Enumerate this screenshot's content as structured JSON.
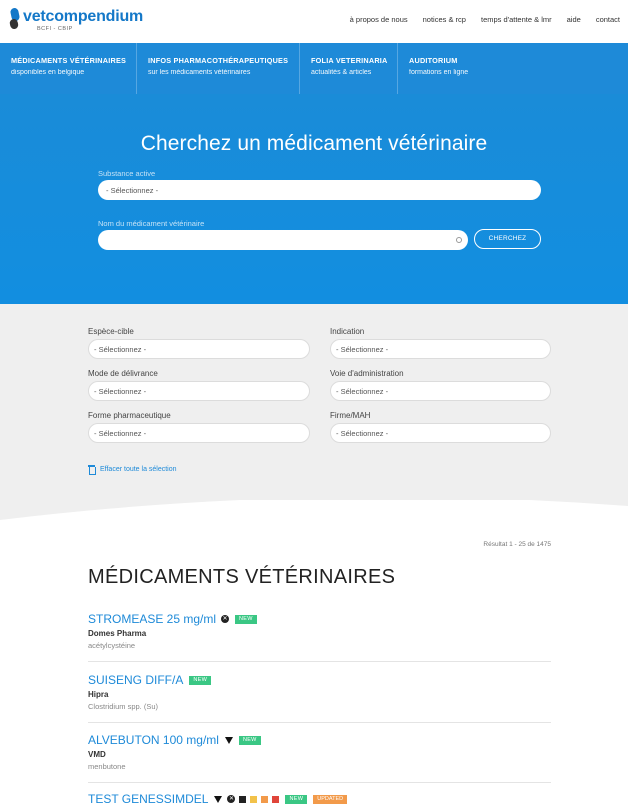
{
  "header": {
    "logo_text": "vetcompendium",
    "logo_sub": "BCFI - CBIP",
    "nav": [
      "à propos de nous",
      "notices & rcp",
      "temps d'attente & lmr",
      "aide",
      "contact"
    ]
  },
  "mainnav": [
    {
      "title": "MÉDICAMENTS VÉTÉRINAIRES",
      "sub": "disponibles en belgique"
    },
    {
      "title": "INFOS PHARMACOTHÉRAPEUTIQUES",
      "sub": "sur les médicaments vétérinaires"
    },
    {
      "title": "FOLIA VETERINARIA",
      "sub": "actualités & articles"
    },
    {
      "title": "AUDITORIUM",
      "sub": "formations en ligne"
    }
  ],
  "search": {
    "heading": "Cherchez un médicament vétérinaire",
    "substance_label": "Substance active",
    "substance_value": "- Sélectionnez -",
    "name_label": "Nom du médicament vétérinaire",
    "name_value": "",
    "button": "CHERCHEZ"
  },
  "filters": {
    "species": {
      "label": "Espèce-cible",
      "value": "- Sélectionnez -"
    },
    "indication": {
      "label": "Indication",
      "value": "- Sélectionnez -"
    },
    "delivery": {
      "label": "Mode de délivrance",
      "value": "- Sélectionnez -"
    },
    "route": {
      "label": "Voie d'administration",
      "value": "- Sélectionnez -"
    },
    "form": {
      "label": "Forme pharmaceutique",
      "value": "- Sélectionnez -"
    },
    "firm": {
      "label": "Firme/MAH",
      "value": "- Sélectionnez -"
    },
    "clear_all": "Effacer toute la sélection"
  },
  "results": {
    "count": "Résultat 1 - 25 de 1475",
    "title": "MÉDICAMENTS VÉTÉRINAIRES",
    "new_badge": "NEW",
    "items": [
      {
        "name": "STROMEASE 25 mg/ml",
        "firm": "Domes Pharma",
        "substance": "acétylcystéine",
        "icons": [
          "x-circle-icon"
        ]
      },
      {
        "name": "SUISENG DIFF/A",
        "firm": "Hipra",
        "substance": "Clostridium spp. (Su)",
        "icons": []
      },
      {
        "name": "ALVEBUTON 100 mg/ml",
        "firm": "VMD",
        "substance": "menbutone",
        "icons": [
          "black-triangle-icon"
        ]
      },
      {
        "name": "TEST GENESSIMDEL",
        "firm": "",
        "substance": "",
        "icons": [
          "black-triangle-icon",
          "x-circle-icon"
        ],
        "extra_badge": "UPDATED"
      }
    ]
  },
  "colors": {
    "brand_blue": "#1e8ad8",
    "new_green": "#3ac784",
    "filter_bg": "#efefef"
  }
}
